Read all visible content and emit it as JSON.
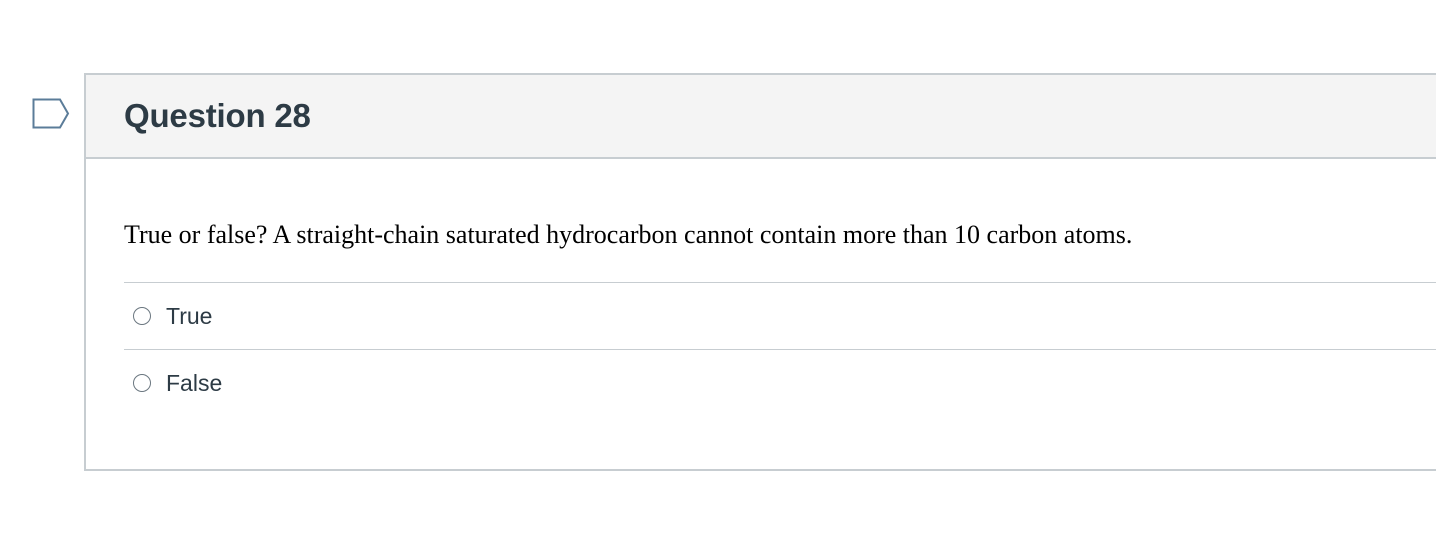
{
  "question": {
    "title": "Question 28",
    "text": "True or false? A straight-chain saturated hydrocarbon cannot contain more than 10 carbon atoms.",
    "flag_icon": "bookmark-flag-icon",
    "answers": [
      {
        "label": "True",
        "selected": false
      },
      {
        "label": "False",
        "selected": false
      }
    ]
  },
  "colors": {
    "header_bg": "#f4f4f4",
    "border": "#c7cdd1",
    "text": "#2d3b45",
    "flag_outline": "#5b7c99"
  }
}
